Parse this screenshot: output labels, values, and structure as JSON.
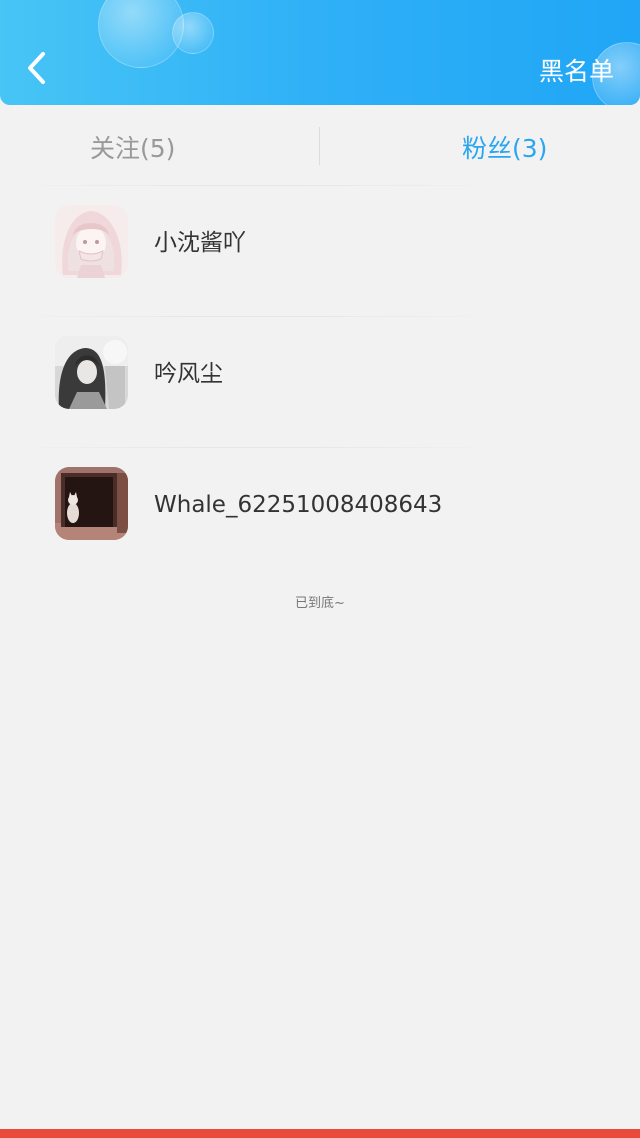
{
  "header": {
    "back_icon": "chevron-left-icon",
    "blacklist_label": "黑名单",
    "gradient": [
      "#47c5f5",
      "#20a6f6"
    ]
  },
  "tabs": [
    {
      "label": "关注(5)",
      "active": false
    },
    {
      "label": "粉丝(3)",
      "active": true
    }
  ],
  "colors": {
    "active_tab": "#2aa6f0",
    "inactive_tab": "#999999",
    "bottom_bar": "#ea4a3c"
  },
  "fans": [
    {
      "name": "小沈酱吖",
      "avatar": "avatar-pink-anime-girl"
    },
    {
      "name": "吟风尘",
      "avatar": "avatar-grey-anime-girl"
    },
    {
      "name": "Whale_62251008408643",
      "avatar": "avatar-cat-doorway"
    }
  ],
  "footer": {
    "end_text": "已到底~"
  }
}
